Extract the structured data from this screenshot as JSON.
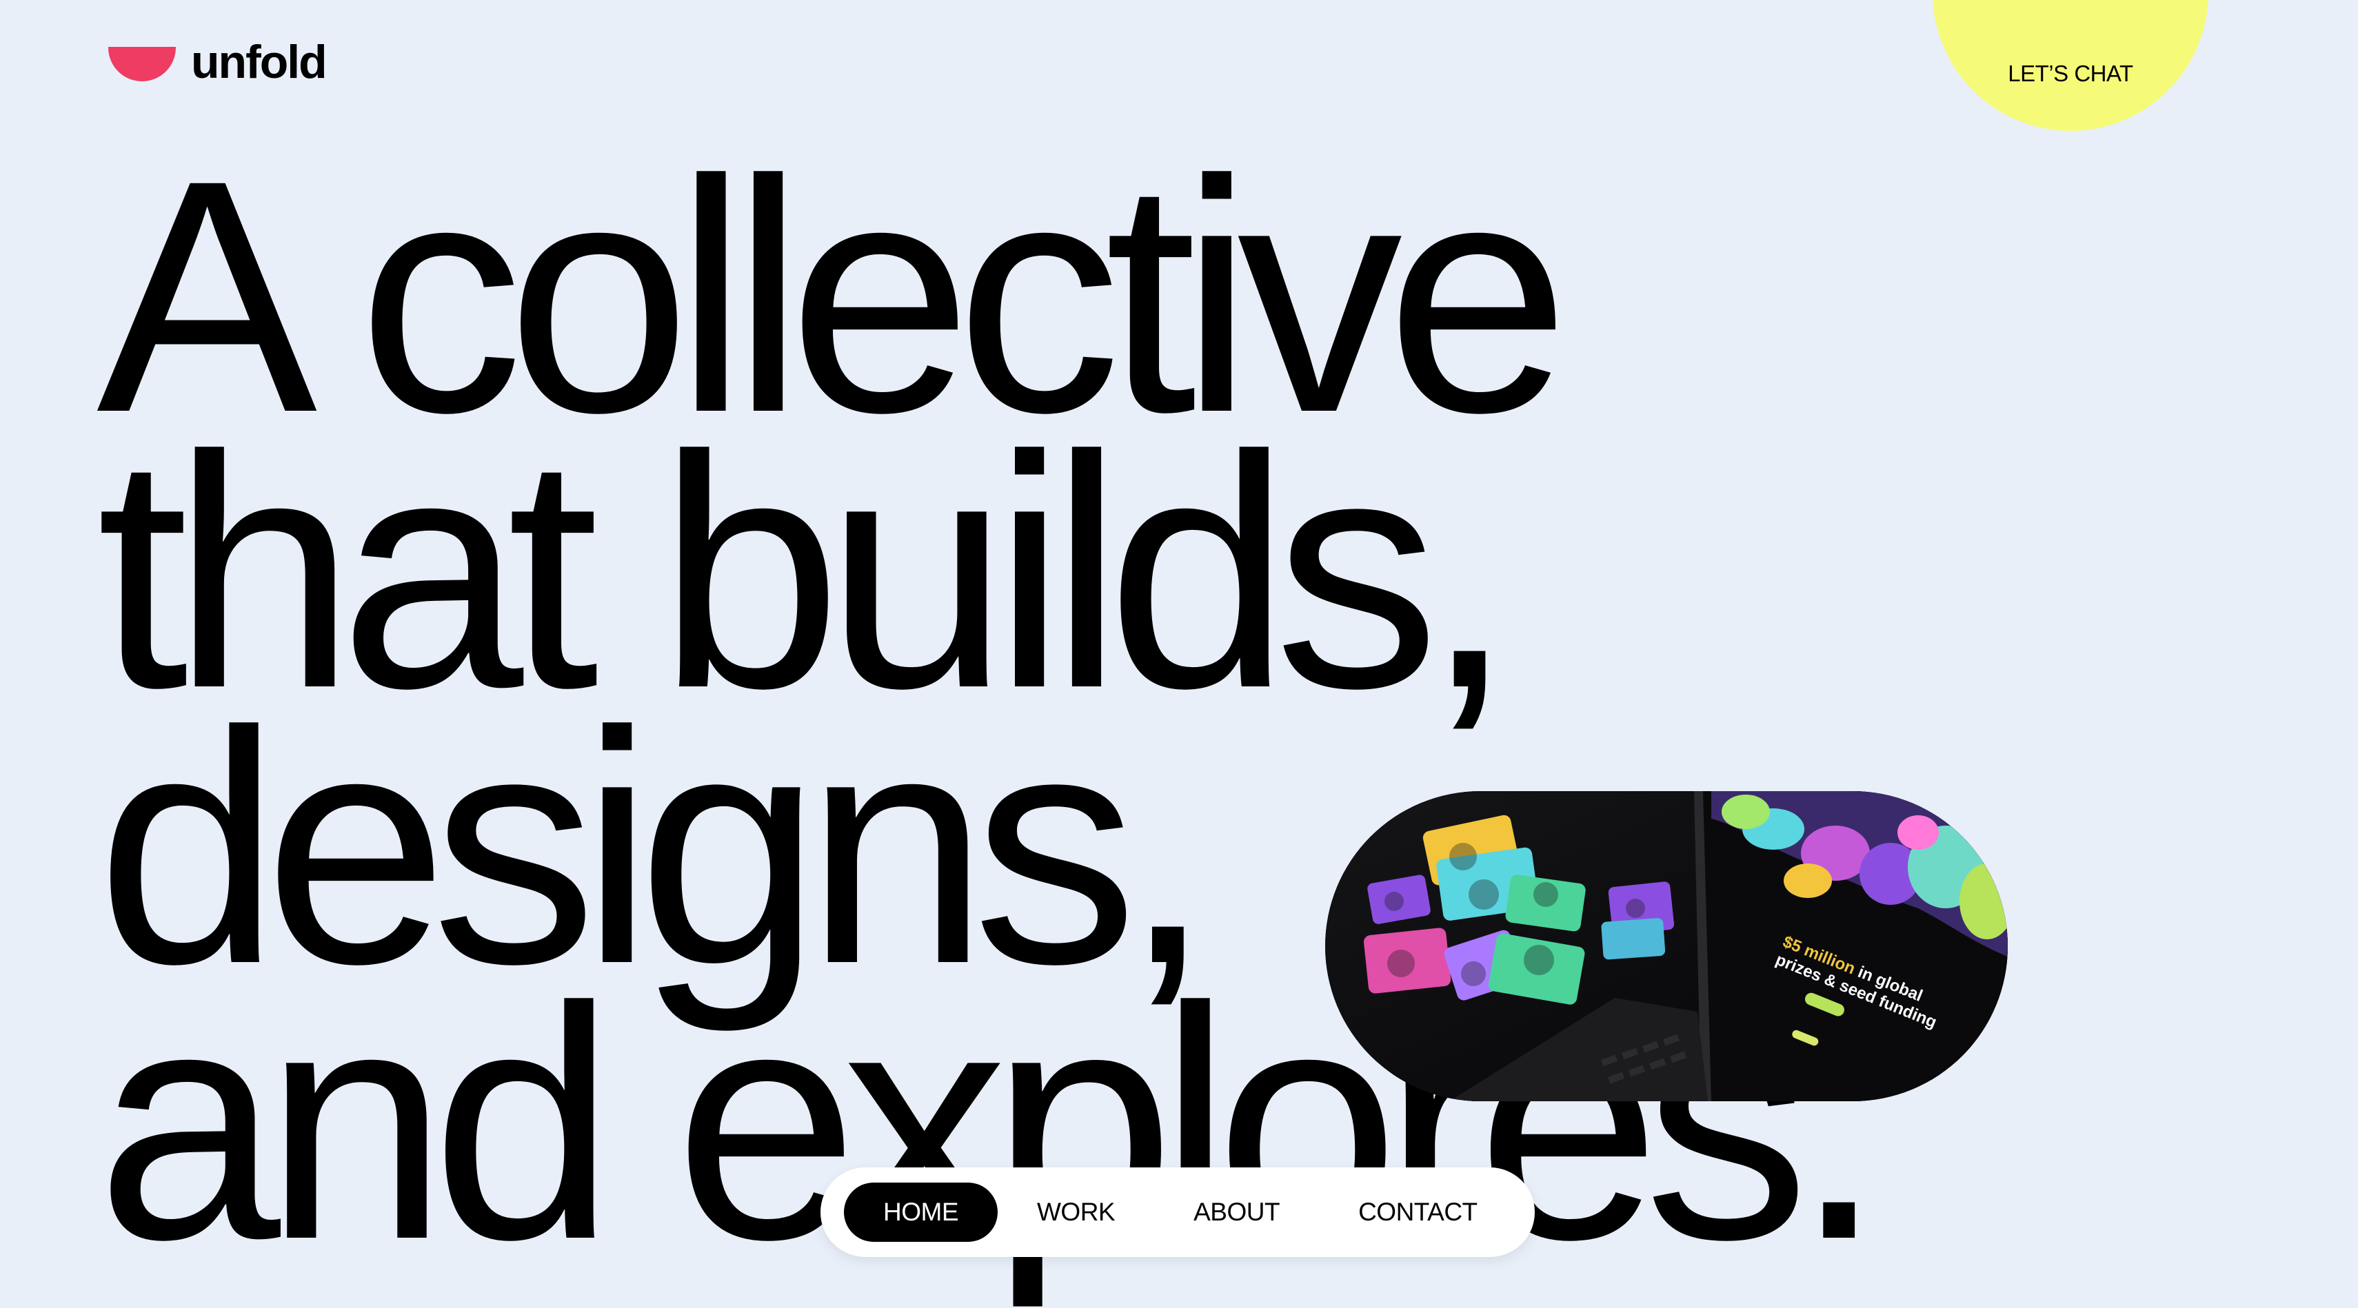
{
  "brand": {
    "name": "unfold",
    "mark_color": "#ef3c63"
  },
  "header": {
    "cta_label": "LET’S CHAT",
    "cta_color": "#f5fb78"
  },
  "hero": {
    "lines": [
      "A collective",
      "that builds,",
      "designs,",
      "and explores."
    ]
  },
  "showcase": {
    "headline_highlight": "$5 million",
    "headline_rest_1": " in global",
    "headline_rest_2": "prizes & seed funding"
  },
  "nav": {
    "items": [
      {
        "label": "HOME",
        "active": true
      },
      {
        "label": "WORK",
        "active": false
      },
      {
        "label": "ABOUT",
        "active": false
      },
      {
        "label": "CONTACT",
        "active": false
      }
    ]
  },
  "colors": {
    "background": "#e8eff9",
    "text": "#000000",
    "nav_bg": "#ffffff"
  }
}
